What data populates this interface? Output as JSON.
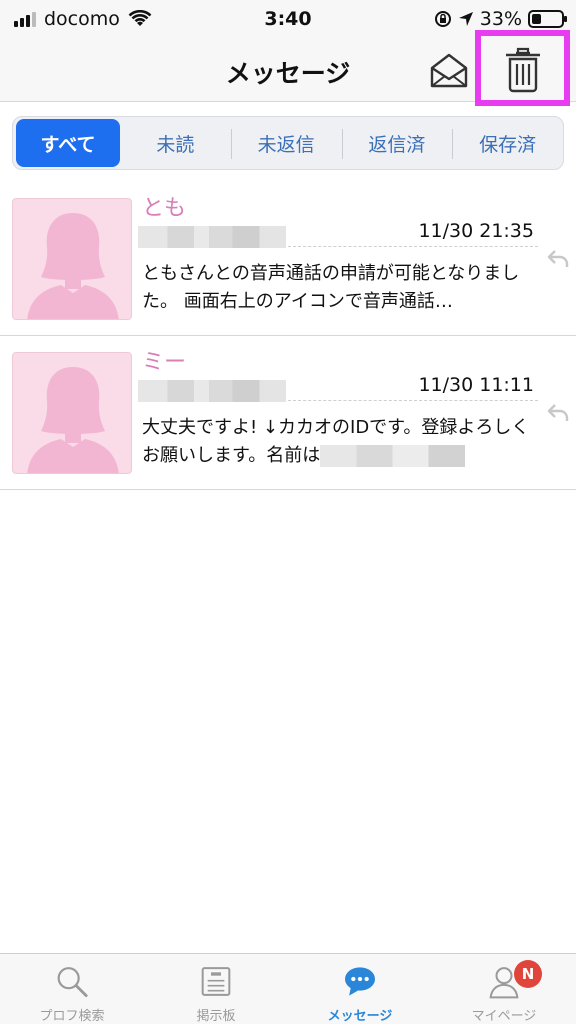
{
  "status_bar": {
    "carrier": "docomo",
    "time": "3:40",
    "battery": "33%",
    "battery_level": 0.33
  },
  "header": {
    "title": "メッセージ",
    "mail_icon": "envelope-open-icon",
    "trash_icon": "trash-icon",
    "highlight_color": "#e83cf0"
  },
  "tabs": [
    {
      "label": "すべて",
      "active": true
    },
    {
      "label": "未読",
      "active": false
    },
    {
      "label": "未返信",
      "active": false
    },
    {
      "label": "返信済",
      "active": false
    },
    {
      "label": "保存済",
      "active": false
    }
  ],
  "messages": [
    {
      "name": "とも",
      "date": "11/30 21:35",
      "body": "ともさんとの音声通話の申請が可能となりました。 画面右上のアイコンで音声通話…"
    },
    {
      "name": "ミー",
      "date": "11/30 11:11",
      "body": "大丈夫ですよ! ↓カカオのIDです。登録よろしくお願いします。名前は"
    }
  ],
  "tabbar": [
    {
      "label": "プロフ検索",
      "icon": "search-icon"
    },
    {
      "label": "掲示板",
      "icon": "board-icon"
    },
    {
      "label": "メッセージ",
      "icon": "chat-bubble-icon",
      "active": true
    },
    {
      "label": "マイページ",
      "icon": "person-icon",
      "badge": "N"
    }
  ],
  "colors": {
    "accent": "#1e6ef0",
    "name_pink": "#d87fb8",
    "tab_text": "#3b6fb6",
    "active_tabbar": "#2a86d8",
    "badge": "#e0453b"
  }
}
